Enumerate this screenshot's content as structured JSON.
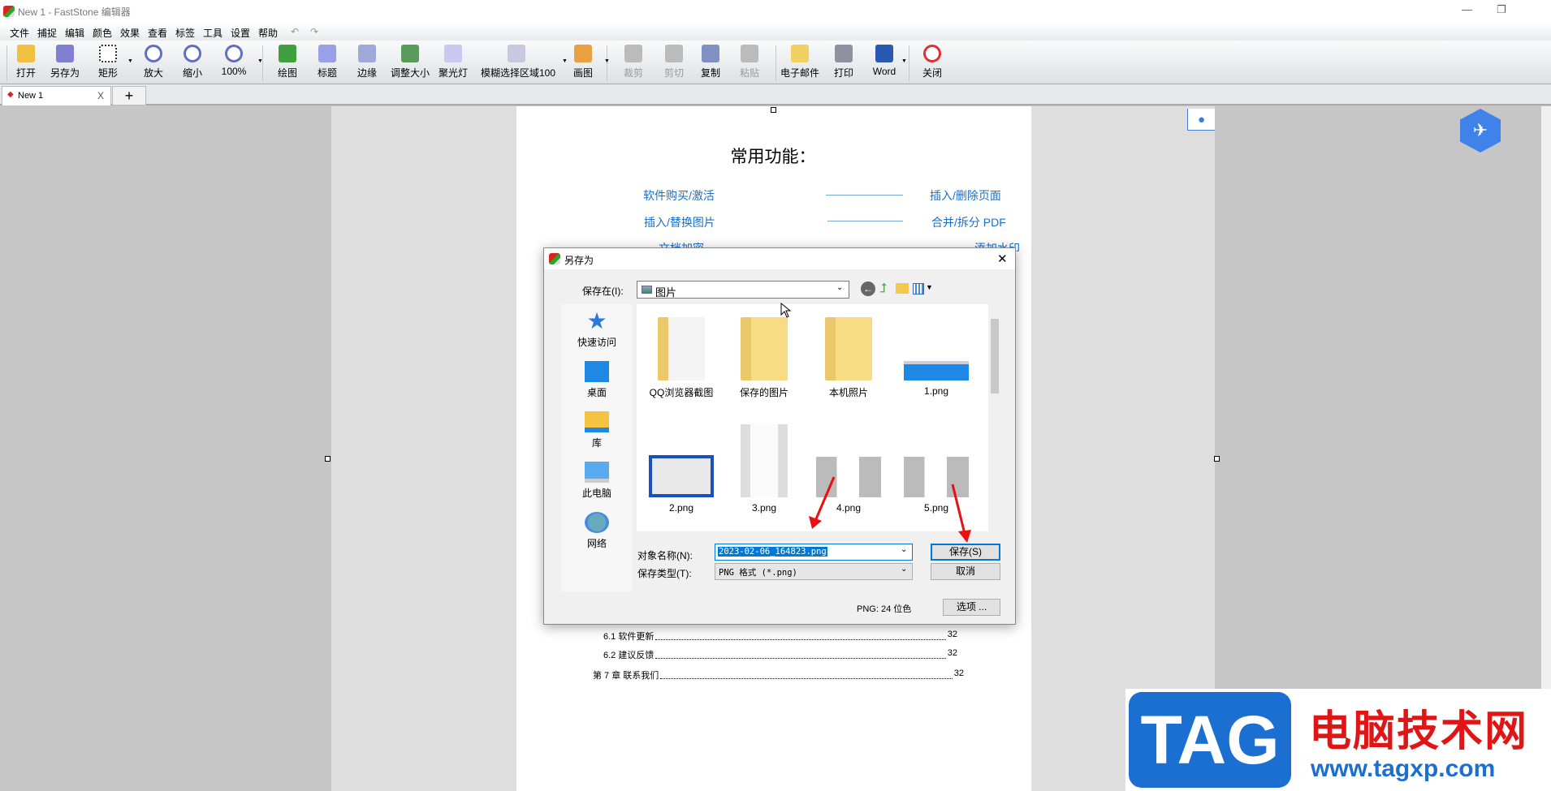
{
  "window": {
    "title": "New 1 - FastStone 编辑器",
    "minimize": "—",
    "restore": "❐"
  },
  "menu": [
    "文件",
    "捕捉",
    "编辑",
    "颜色",
    "效果",
    "查看",
    "标签",
    "工具",
    "设置",
    "帮助"
  ],
  "undo": "↶",
  "redo": "↷",
  "toolbar": [
    {
      "label": "打开",
      "icon": "open-folder-icon",
      "color": "#f0c040"
    },
    {
      "label": "另存为",
      "icon": "save-disk-icon",
      "color": "#8080d0"
    },
    {
      "label": "矩形",
      "icon": "rectangle-select-icon",
      "color": "#ffffff"
    },
    {
      "label": "放大",
      "icon": "zoom-in-icon",
      "color": "#6070c0"
    },
    {
      "label": "缩小",
      "icon": "zoom-out-icon",
      "color": "#6070c0"
    },
    {
      "label": "100%",
      "icon": "zoom-actual-icon",
      "color": "#6070c0"
    },
    {
      "label": "绘图",
      "icon": "draw-icon",
      "color": "#40a040"
    },
    {
      "label": "标题",
      "icon": "caption-icon",
      "color": "#9aa0e8"
    },
    {
      "label": "边缘",
      "icon": "edge-icon",
      "color": "#a0a8d8"
    },
    {
      "label": "调整大小",
      "icon": "resize-icon",
      "color": "#5a9a5a"
    },
    {
      "label": "聚光灯",
      "icon": "spotlight-icon",
      "color": "#c8c8f0"
    },
    {
      "label": "模糊选择区域100",
      "icon": "blur-icon",
      "color": "#c8c8e0"
    },
    {
      "label": "画图",
      "icon": "paint-icon",
      "color": "#e8a040"
    },
    {
      "label": "裁剪",
      "icon": "crop-icon",
      "color": "#bbbbbb"
    },
    {
      "label": "剪切",
      "icon": "cut-icon",
      "color": "#bbbbbb"
    },
    {
      "label": "复制",
      "icon": "copy-icon",
      "color": "#8090c0"
    },
    {
      "label": "粘贴",
      "icon": "paste-icon",
      "color": "#bbbbbb"
    },
    {
      "label": "电子邮件",
      "icon": "email-icon",
      "color": "#f0d060"
    },
    {
      "label": "打印",
      "icon": "print-icon",
      "color": "#9090a0"
    },
    {
      "label": "Word",
      "icon": "word-icon",
      "color": "#2a5ab0"
    },
    {
      "label": "关闭",
      "icon": "power-icon",
      "color": "#e03030"
    }
  ],
  "tabs": {
    "active": "New 1",
    "close": "X",
    "add": "+"
  },
  "document": {
    "heading": "常用功能：",
    "links": [
      [
        "软件购买/激活",
        "插入/删除页面"
      ],
      [
        "插入/替换图片",
        "合并/拆分 PDF"
      ],
      [
        "文档加密",
        "添加水印"
      ]
    ],
    "toc": [
      {
        "label": "6.1  软件更新",
        "page": "32"
      },
      {
        "label": "6.2  建议反馈",
        "page": "32"
      },
      {
        "label": "第 7 章   联系我们",
        "page": "32"
      }
    ]
  },
  "dialog": {
    "title": "另存为",
    "save_in_label": "保存在(I):",
    "save_in_value": "图片",
    "places": [
      "快速访问",
      "桌面",
      "库",
      "此电脑",
      "网络"
    ],
    "files": [
      "QQ浏览器截图",
      "保存的图片",
      "本机照片",
      "1.png",
      "2.png",
      "3.png",
      "4.png",
      "5.png"
    ],
    "filename_label": "对象名称(N):",
    "filename_value": "2023-02-06_164823.png",
    "filetype_label": "保存类型(T):",
    "filetype_value": "PNG 格式 (*.png)",
    "save_button": "保存(S)",
    "cancel_button": "取消",
    "info": "PNG: 24 位色",
    "options_button": "选项 ...",
    "close": "✕"
  },
  "watermark": {
    "brand": "TAG",
    "text": "电脑技术网",
    "url": "www.tagxp.com"
  },
  "colors": {
    "accent": "#0078d7",
    "link": "#1a6fc7",
    "arrow": "#e81010"
  }
}
